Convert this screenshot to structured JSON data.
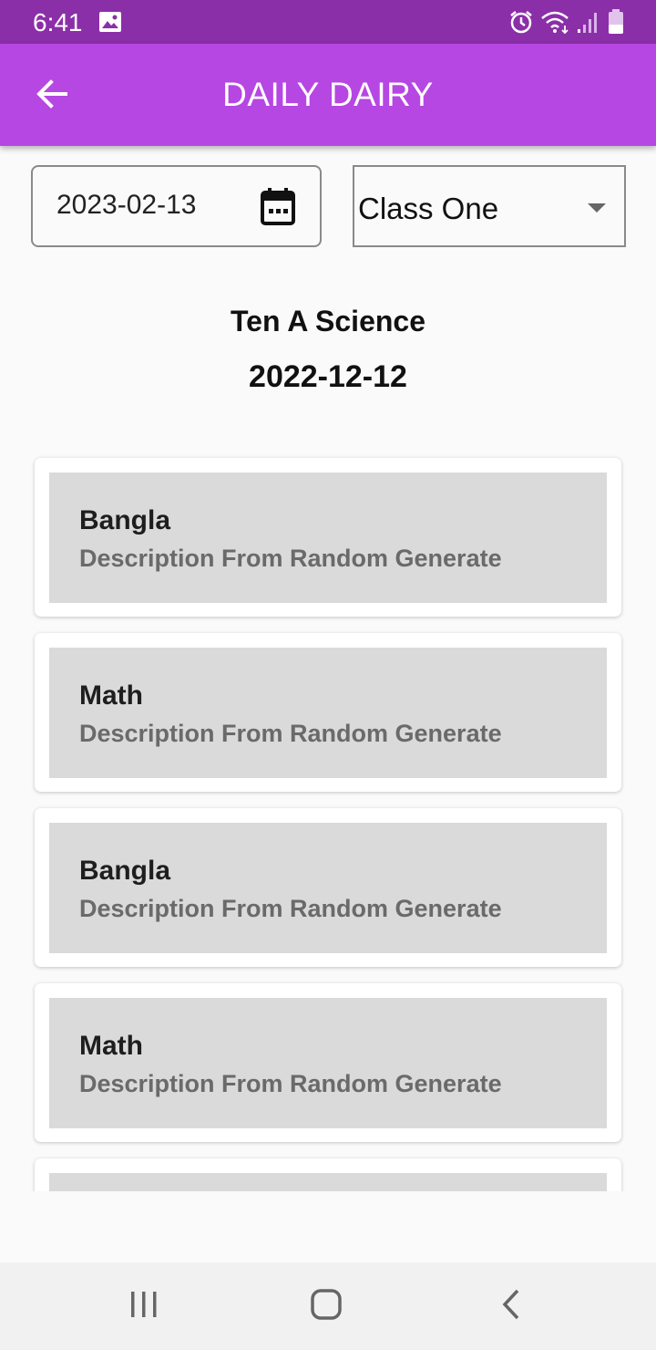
{
  "status_bar": {
    "time": "6:41",
    "icons": [
      "image-icon",
      "alarm-icon",
      "wifi-icon",
      "signal-icon",
      "battery-icon"
    ]
  },
  "app_bar": {
    "title": "DAILY DAIRY",
    "back_icon": "arrow-back-icon",
    "color": "#b647e3"
  },
  "filters": {
    "date_value": "2023-02-13",
    "date_icon": "calendar-icon",
    "class_value": "Class One",
    "class_icon": "dropdown-arrow-icon"
  },
  "header": {
    "class_name": "Ten A Science",
    "date": "2022-12-12"
  },
  "entries": [
    {
      "subject": "Bangla",
      "description": "Description From Random Generate"
    },
    {
      "subject": "Math",
      "description": "Description From Random Generate"
    },
    {
      "subject": "Bangla",
      "description": "Description From Random Generate"
    },
    {
      "subject": "Math",
      "description": "Description From Random Generate"
    },
    {
      "subject": "",
      "description": ""
    }
  ],
  "nav_bar": {
    "icons": [
      "recent-apps-icon",
      "home-icon",
      "back-icon"
    ]
  }
}
